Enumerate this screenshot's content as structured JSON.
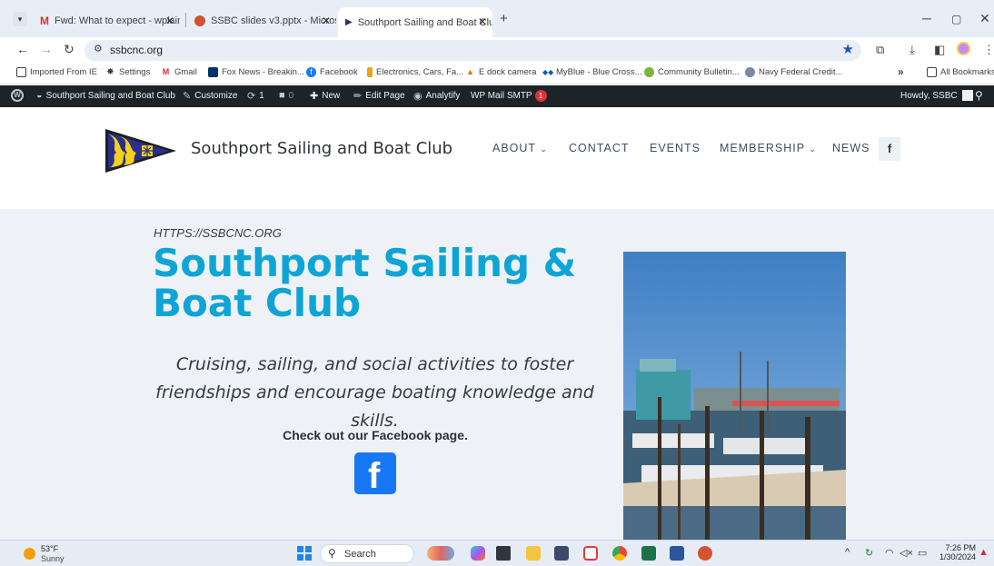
{
  "browser": {
    "tabs": [
      {
        "title": "Fwd: What to expect - wplaine",
        "icon": "gmail-icon",
        "active": false
      },
      {
        "title": "SSBC slides v3.pptx - Microsoft",
        "icon": "powerpoint-icon",
        "active": false
      },
      {
        "title": "Southport Sailing and Boat Clu",
        "icon": "ssbc-flag-icon",
        "active": true
      }
    ],
    "new_tab": "+",
    "address": "ssbcnc.org",
    "bookmarks": [
      {
        "label": "Imported From IE",
        "icon": "folder-icon"
      },
      {
        "label": "Settings",
        "icon": "gear-icon"
      },
      {
        "label": "Gmail",
        "icon": "gmail-icon"
      },
      {
        "label": "Fox News - Breakin...",
        "icon": "foxnews-icon"
      },
      {
        "label": "Facebook",
        "icon": "facebook-icon"
      },
      {
        "label": "Electronics, Cars, Fa...",
        "icon": "ebay-icon"
      },
      {
        "label": "E dock camera",
        "icon": "camera-icon"
      },
      {
        "label": "MyBlue - Blue Cross...",
        "icon": "bluecross-icon"
      },
      {
        "label": "Community Bulletin...",
        "icon": "bulletin-icon"
      },
      {
        "label": "Navy Federal Credit...",
        "icon": "navyfed-icon"
      }
    ],
    "bookmarks_overflow": "»",
    "all_bookmarks": "All Bookmarks"
  },
  "wp_admin_bar": {
    "site_name": "Southport Sailing and Boat Club",
    "customize": "Customize",
    "updates_count": "1",
    "comments_count": "0",
    "new": "New",
    "edit_page": "Edit Page",
    "analytify": "Analytify",
    "wp_mail_smtp": "WP Mail SMTP",
    "wp_mail_badge": "1",
    "howdy": "Howdy, SSBC"
  },
  "site": {
    "title": "Southport Sailing and Boat Club",
    "nav": [
      {
        "label": "ABOUT",
        "dropdown": true
      },
      {
        "label": "CONTACT",
        "dropdown": false
      },
      {
        "label": "EVENTS",
        "dropdown": false
      },
      {
        "label": "MEMBERSHIP",
        "dropdown": true
      },
      {
        "label": "NEWS",
        "dropdown": false
      }
    ],
    "nav_facebook": "f",
    "hero": {
      "url_label": "HTTPS://SSBCNC.ORG",
      "title": "Southport Sailing & Boat Club",
      "tagline": "Cruising, sailing, and social activities to foster friendships and encourage boating knowledge and skills.",
      "facebook_cta": "Check out our Facebook page.",
      "facebook_logo": "f"
    },
    "colors": {
      "accent": "#0ea5d6",
      "hero_bg": "#eef2f6",
      "facebook": "#1877f2"
    }
  },
  "taskbar": {
    "weather_temp": "53°F",
    "weather_desc": "Sunny",
    "search_label": "Search",
    "time": "7:26 PM",
    "date": "1/30/2024"
  }
}
